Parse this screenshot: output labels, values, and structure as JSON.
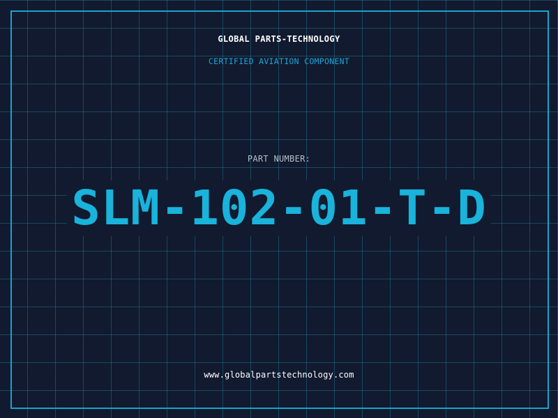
{
  "header": {
    "company_name": "GLOBAL PARTS-TECHNOLOGY",
    "tagline": "CERTIFIED AVIATION COMPONENT"
  },
  "part": {
    "label": "PART NUMBER:",
    "number": "SLM-102-01-T-D"
  },
  "footer": {
    "website": "www.globalpartstechnology.com"
  },
  "colors": {
    "background": "#111a2e",
    "grid_line": "#226e8c",
    "accent": "#19b3dc",
    "text_light": "#ffffff",
    "text_muted": "#b7bfc9"
  }
}
